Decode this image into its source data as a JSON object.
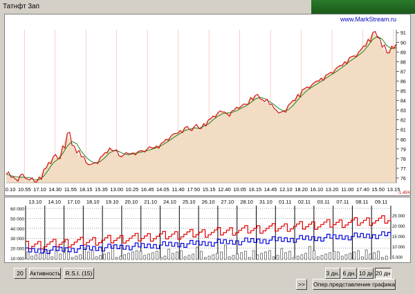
{
  "window": {
    "title": "Татнфт 3ап"
  },
  "watermark": "www.MarkStream.ru",
  "colors": {
    "price_line": "#d01010",
    "ma_line": "#208020",
    "area_fill": "#f2dcc4",
    "buy_volume": "#e00000",
    "sell_volume": "#0000e0"
  },
  "main_chart": {
    "y_ticks": [
      "91",
      "90",
      "89",
      "88",
      "87",
      "86",
      "85",
      "84",
      "83",
      "82",
      "81",
      "80",
      "79",
      "78",
      "77",
      "76"
    ],
    "x_ticks": [
      "10.10",
      "10.55",
      "17.10",
      "14.30",
      "11.55",
      "18.15",
      "15.35",
      "13.00",
      "10.25",
      "16.45",
      "14.05",
      "11.40",
      "17.50",
      "15.15",
      "12.40",
      "10.05",
      "16.15",
      "14.45",
      "12.10",
      "18.20",
      "16.10",
      "13.20",
      "11.00",
      "17.40",
      "15.50",
      "13.15"
    ],
    "corner_label": "-1.45%"
  },
  "sub_chart": {
    "dates": [
      "13.10",
      "14.10",
      "17.10",
      "18.10",
      "19.10",
      "20.10",
      "21.10",
      "24.10",
      "25.10",
      "26.10",
      "27.10",
      "28.10",
      "31.10",
      "01.11",
      "02.11",
      "03.11",
      "07.11",
      "08.11",
      "09.11"
    ],
    "left_ticks": [
      "60 000",
      "50 000",
      "40 000",
      "30 000",
      "20 000",
      "10 000"
    ],
    "right_ticks": [
      "25 000",
      "20 000",
      "15 000",
      "10 000",
      "5 000"
    ]
  },
  "toolbar": {
    "period_value": "20",
    "activity_label": "Активность",
    "rsi_label": "R.S.I. (15)",
    "range_3d": "3 дн.",
    "range_6d": "6 дн.",
    "range_10d": "10 дн.",
    "range_20d": "20 дн.",
    "next_label": ">>",
    "oper_label": "Опер.представление графика"
  },
  "chart_data": {
    "type": "area",
    "y_range": [
      75.5,
      91.3
    ],
    "price_series": [
      76.4,
      76.1,
      75.9,
      76.3,
      76.0,
      75.8,
      75.6,
      76.1,
      76.9,
      77.6,
      78.2,
      78.0,
      79.3,
      80.6,
      79.4,
      78.6,
      78.2,
      77.6,
      77.4,
      77.6,
      78.1,
      78.6,
      79.1,
      78.8,
      78.3,
      78.4,
      78.5,
      78.6,
      78.7,
      78.8,
      79.0,
      79.1,
      79.3,
      79.6,
      80.0,
      80.3,
      80.6,
      80.9,
      81.2,
      81.0,
      81.3,
      81.1,
      81.6,
      82.0,
      82.4,
      82.7,
      82.8,
      82.6,
      82.9,
      83.3,
      83.4,
      83.6,
      84.3,
      84.5,
      84.2,
      83.9,
      83.6,
      83.2,
      82.7,
      82.9,
      83.5,
      84.0,
      84.6,
      85.1,
      85.4,
      85.6,
      86.0,
      86.3,
      86.6,
      86.9,
      87.2,
      87.6,
      88.0,
      88.4,
      88.6,
      89.0,
      89.6,
      90.3,
      91.0,
      90.5,
      89.5,
      88.9,
      89.6,
      89.8
    ]
  }
}
